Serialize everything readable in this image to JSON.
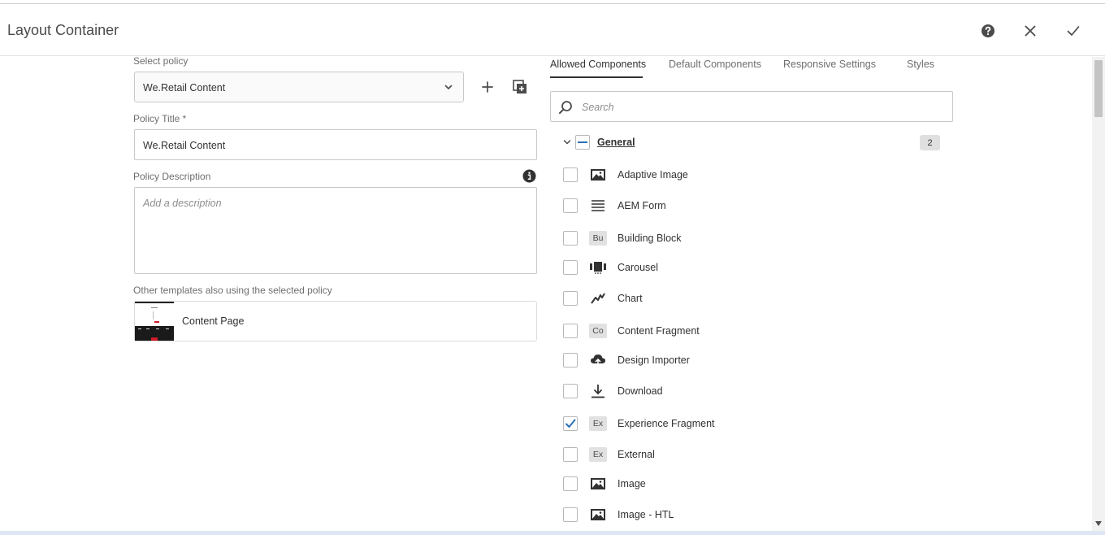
{
  "header": {
    "title": "Layout Container"
  },
  "policy": {
    "select_label": "Select policy",
    "select_value": "We.Retail Content",
    "title_label": "Policy Title *",
    "title_value": "We.Retail Content",
    "description_label": "Policy Description",
    "description_placeholder": "Add a description",
    "other_templates_label": "Other templates also using the selected policy",
    "templates": [
      {
        "label": "Content Page"
      }
    ]
  },
  "tabs": [
    {
      "label": "Allowed Components",
      "active": true
    },
    {
      "label": "Default Components",
      "active": false
    },
    {
      "label": "Responsive Settings",
      "active": false
    },
    {
      "label": "Styles",
      "active": false
    }
  ],
  "search": {
    "placeholder": "Search"
  },
  "group": {
    "name": "General",
    "count": "2"
  },
  "components": [
    {
      "name": "Adaptive Image",
      "icon": "image-icon",
      "checked": false
    },
    {
      "name": "AEM Form",
      "icon": "form-lines-icon",
      "checked": false
    },
    {
      "name": "Building Block",
      "icon": "abbr",
      "abbr": "Bu",
      "checked": false
    },
    {
      "name": "Carousel",
      "icon": "carousel-icon",
      "checked": false
    },
    {
      "name": "Chart",
      "icon": "chart-line-icon",
      "checked": false
    },
    {
      "name": "Content Fragment",
      "icon": "abbr",
      "abbr": "Co",
      "checked": false
    },
    {
      "name": "Design Importer",
      "icon": "cloud-upload-icon",
      "checked": false
    },
    {
      "name": "Download",
      "icon": "download-icon",
      "checked": false
    },
    {
      "name": "Experience Fragment",
      "icon": "abbr",
      "abbr": "Ex",
      "checked": true
    },
    {
      "name": "External",
      "icon": "abbr",
      "abbr": "Ex",
      "checked": false
    },
    {
      "name": "Image",
      "icon": "image-icon",
      "checked": false
    },
    {
      "name": "Image - HTL",
      "icon": "image-icon",
      "checked": false
    }
  ],
  "colors": {
    "accent": "#2c6fb6",
    "checkmark": "#2c6fb6"
  }
}
